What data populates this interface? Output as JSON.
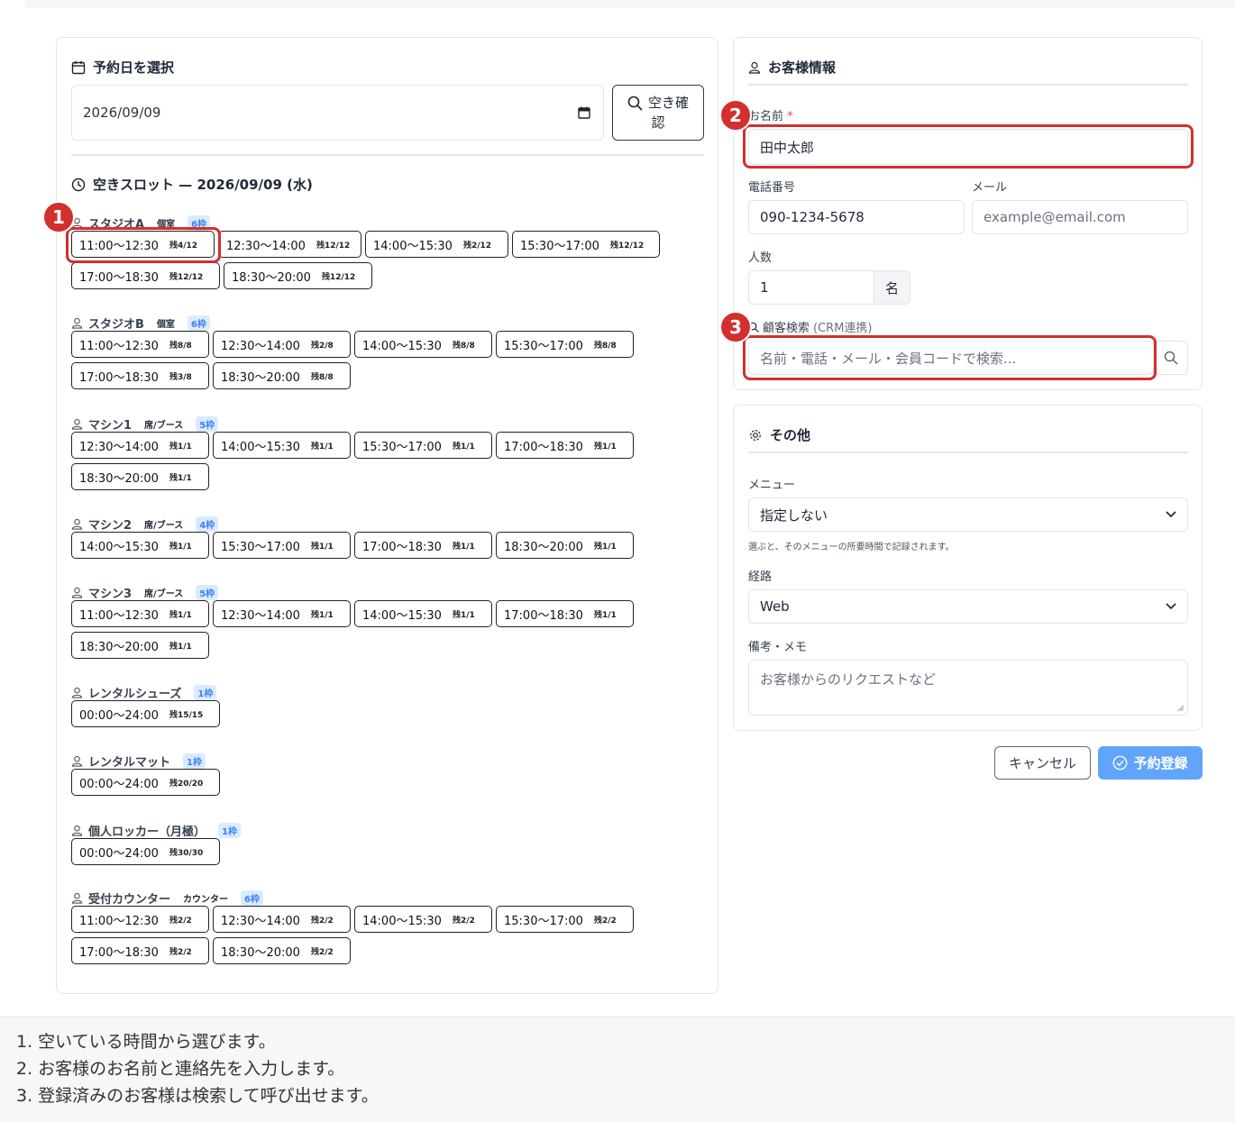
{
  "date_section": {
    "title": "予約日を選択",
    "date_value": "2026/09/09",
    "check_button_line1": "空き確",
    "check_button_line2": "認"
  },
  "slots_section": {
    "title": "空きスロット — 2026/09/09 (水)"
  },
  "resources": [
    {
      "name": "スタジオA",
      "type": "個室",
      "badge": "6枠",
      "slots": [
        {
          "time": "11:00〜12:30",
          "remaining": "残4/12"
        },
        {
          "time": "12:30〜14:00",
          "remaining": "残12/12"
        },
        {
          "time": "14:00〜15:30",
          "remaining": "残2/12"
        },
        {
          "time": "15:30〜17:00",
          "remaining": "残12/12"
        },
        {
          "time": "17:00〜18:30",
          "remaining": "残12/12"
        },
        {
          "time": "18:30〜20:00",
          "remaining": "残12/12"
        }
      ]
    },
    {
      "name": "スタジオB",
      "type": "個室",
      "badge": "6枠",
      "slots": [
        {
          "time": "11:00〜12:30",
          "remaining": "残8/8"
        },
        {
          "time": "12:30〜14:00",
          "remaining": "残2/8"
        },
        {
          "time": "14:00〜15:30",
          "remaining": "残8/8"
        },
        {
          "time": "15:30〜17:00",
          "remaining": "残8/8"
        },
        {
          "time": "17:00〜18:30",
          "remaining": "残3/8"
        },
        {
          "time": "18:30〜20:00",
          "remaining": "残8/8"
        }
      ]
    },
    {
      "name": "マシン1",
      "type": "席/ブース",
      "badge": "5枠",
      "slots": [
        {
          "time": "12:30〜14:00",
          "remaining": "残1/1"
        },
        {
          "time": "14:00〜15:30",
          "remaining": "残1/1"
        },
        {
          "time": "15:30〜17:00",
          "remaining": "残1/1"
        },
        {
          "time": "17:00〜18:30",
          "remaining": "残1/1"
        },
        {
          "time": "18:30〜20:00",
          "remaining": "残1/1"
        }
      ]
    },
    {
      "name": "マシン2",
      "type": "席/ブース",
      "badge": "4枠",
      "slots": [
        {
          "time": "14:00〜15:30",
          "remaining": "残1/1"
        },
        {
          "time": "15:30〜17:00",
          "remaining": "残1/1"
        },
        {
          "time": "17:00〜18:30",
          "remaining": "残1/1"
        },
        {
          "time": "18:30〜20:00",
          "remaining": "残1/1"
        }
      ]
    },
    {
      "name": "マシン3",
      "type": "席/ブース",
      "badge": "5枠",
      "slots": [
        {
          "time": "11:00〜12:30",
          "remaining": "残1/1"
        },
        {
          "time": "12:30〜14:00",
          "remaining": "残1/1"
        },
        {
          "time": "14:00〜15:30",
          "remaining": "残1/1"
        },
        {
          "time": "17:00〜18:30",
          "remaining": "残1/1"
        },
        {
          "time": "18:30〜20:00",
          "remaining": "残1/1"
        }
      ]
    },
    {
      "name": "レンタルシューズ",
      "type": "",
      "badge": "1枠",
      "slots": [
        {
          "time": "00:00〜24:00",
          "remaining": "残15/15"
        }
      ]
    },
    {
      "name": "レンタルマット",
      "type": "",
      "badge": "1枠",
      "slots": [
        {
          "time": "00:00〜24:00",
          "remaining": "残20/20"
        }
      ]
    },
    {
      "name": "個人ロッカー（月極）",
      "type": "",
      "badge": "1枠",
      "slots": [
        {
          "time": "00:00〜24:00",
          "remaining": "残30/30"
        }
      ]
    },
    {
      "name": "受付カウンター",
      "type": "カウンター",
      "badge": "6枠",
      "slots": [
        {
          "time": "11:00〜12:30",
          "remaining": "残2/2"
        },
        {
          "time": "12:30〜14:00",
          "remaining": "残2/2"
        },
        {
          "time": "14:00〜15:30",
          "remaining": "残2/2"
        },
        {
          "time": "15:30〜17:00",
          "remaining": "残2/2"
        },
        {
          "time": "17:00〜18:30",
          "remaining": "残2/2"
        },
        {
          "time": "18:30〜20:00",
          "remaining": "残2/2"
        }
      ]
    }
  ],
  "customer": {
    "title": "お客様情報",
    "name_label": "お名前",
    "required_mark": "*",
    "name_value": "田中太郎",
    "phone_label": "電話番号",
    "phone_value": "090-1234-5678",
    "email_label": "メール",
    "email_placeholder": "example@email.com",
    "people_label": "人数",
    "people_value": "1",
    "people_unit": "名",
    "search_label": "顧客検索",
    "search_label_suffix": "(CRM連携)",
    "search_placeholder": "名前・電話・メール・会員コードで検索..."
  },
  "other": {
    "title": "その他",
    "menu_label": "メニュー",
    "menu_value": "指定しない",
    "menu_help": "選ぶと、そのメニューの所要時間で記録されます。",
    "route_label": "経路",
    "route_value": "Web",
    "memo_label": "備考・メモ",
    "memo_placeholder": "お客様からのリクエストなど"
  },
  "actions": {
    "cancel": "キャンセル",
    "submit": "予約登録"
  },
  "markers": [
    "1",
    "2",
    "3"
  ],
  "footer": [
    "1. 空いている時間から選びます。",
    "2. お客様のお名前と連絡先を入力します。",
    "3. 登録済みのお客様は検索して呼び出せます。"
  ],
  "colors": {
    "highlight": "#d32f2f",
    "primary": "#60a5fa",
    "badge_bg": "#dbeafe",
    "badge_text": "#3b82f6"
  }
}
